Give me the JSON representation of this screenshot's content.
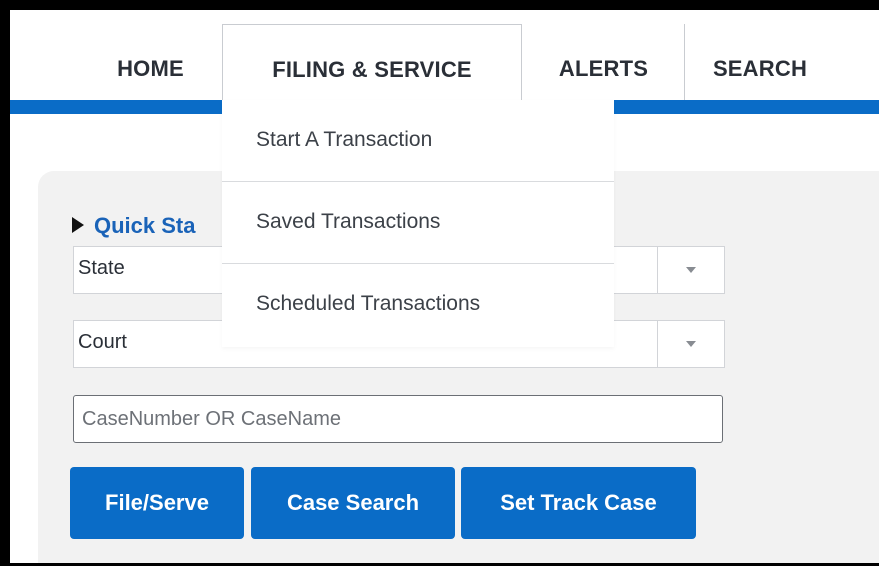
{
  "nav": {
    "items": [
      {
        "label": "HOME"
      },
      {
        "label": "FILING & SERVICE"
      },
      {
        "label": "ALERTS"
      },
      {
        "label": "SEARCH"
      }
    ],
    "active": "FILING & SERVICE"
  },
  "dropdown": {
    "items": [
      {
        "label": "Start A Transaction"
      },
      {
        "label": "Saved Transactions"
      },
      {
        "label": "Scheduled Transactions"
      }
    ]
  },
  "quick_start": {
    "title": "Quick Sta",
    "state_select": {
      "selected": "State"
    },
    "court_select": {
      "selected": "Court"
    },
    "case_input": {
      "placeholder": "CaseNumber OR CaseName",
      "value": ""
    },
    "buttons": {
      "file_serve": "File/Serve",
      "case_search": "Case Search",
      "set_track_case": "Set Track Case"
    }
  },
  "colors": {
    "accent": "#0a6cc7",
    "link": "#1a63b8",
    "panel_bg": "#f2f2f2"
  },
  "icons": {
    "section_toggle": "triangle-right-icon",
    "select_caret": "chevron-down-icon"
  }
}
